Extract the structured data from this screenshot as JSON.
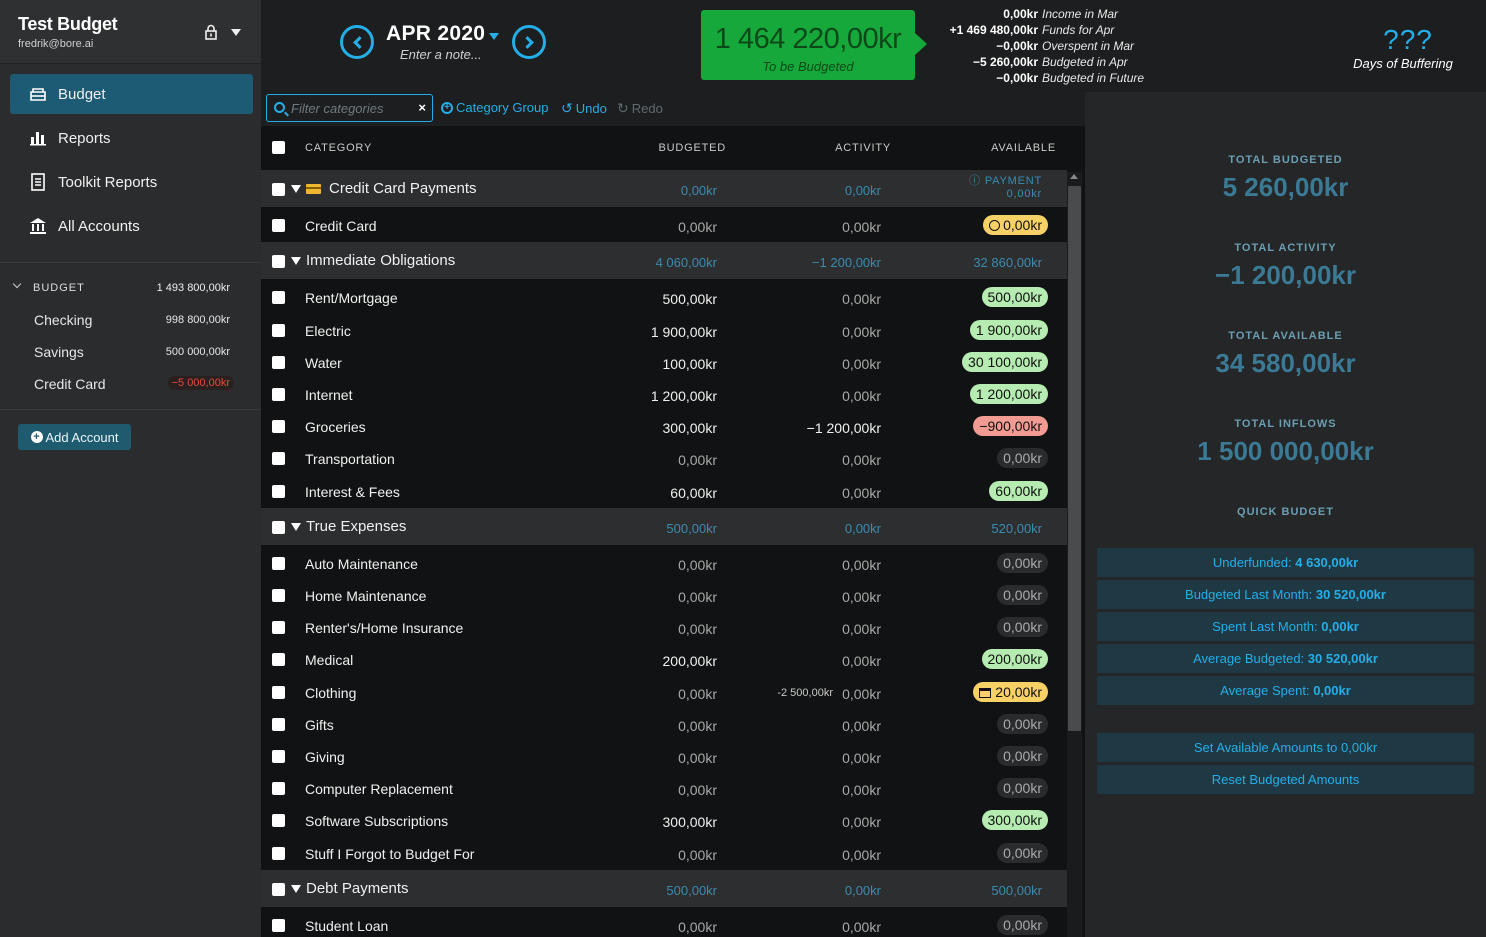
{
  "sidebar": {
    "title": "Test Budget",
    "email": "fredrik@bore.ai",
    "nav": [
      {
        "label": "Budget",
        "icon": "bank-card-icon"
      },
      {
        "label": "Reports",
        "icon": "bar-chart-icon"
      },
      {
        "label": "Toolkit Reports",
        "icon": "document-icon"
      },
      {
        "label": "All Accounts",
        "icon": "bank-icon"
      }
    ],
    "budget_header": {
      "label": "BUDGET",
      "value": "1 493 800,00kr"
    },
    "accounts": [
      {
        "name": "Checking",
        "value": "998 800,00kr"
      },
      {
        "name": "Savings",
        "value": "500 000,00kr"
      },
      {
        "name": "Credit Card",
        "value": "−5 000,00kr"
      }
    ],
    "add_account": "Add Account"
  },
  "header": {
    "month": "APR 2020",
    "note_placeholder": "Enter a note...",
    "to_be_budgeted": "1 464 220,00kr",
    "to_be_budgeted_label": "To be Budgeted",
    "summary": [
      {
        "amount": "0,00kr",
        "label": "Income in Mar"
      },
      {
        "amount": "+1 469 480,00kr",
        "label": "Funds for Apr"
      },
      {
        "amount": "−0,00kr",
        "label": "Overspent in Mar"
      },
      {
        "amount": "−5 260,00kr",
        "label": "Budgeted in Apr"
      },
      {
        "amount": "−0,00kr",
        "label": "Budgeted in Future"
      }
    ],
    "days_of_buffering_value": "???",
    "days_of_buffering_label": "Days of Buffering"
  },
  "toolbar": {
    "filter_placeholder": "Filter categories",
    "category_group": "Category Group",
    "undo": "Undo",
    "redo": "Redo"
  },
  "columns": {
    "category": "CATEGORY",
    "budgeted": "BUDGETED",
    "activity": "ACTIVITY",
    "available": "AVAILABLE"
  },
  "groups": {
    "ccp": {
      "name": "Credit Card Payments",
      "budgeted": "0,00kr",
      "activity": "0,00kr",
      "payment_label": "PAYMENT",
      "available": "0,00kr"
    },
    "io": {
      "name": "Immediate Obligations",
      "budgeted": "4 060,00kr",
      "activity": "−1 200,00kr",
      "available": "32 860,00kr"
    },
    "te": {
      "name": "True Expenses",
      "budgeted": "500,00kr",
      "activity": "0,00kr",
      "available": "520,00kr"
    },
    "dp": {
      "name": "Debt Payments",
      "budgeted": "500,00kr",
      "activity": "0,00kr",
      "available": "500,00kr"
    }
  },
  "rows": {
    "credit_card": {
      "name": "Credit Card",
      "budgeted": "0,00kr",
      "activity": "0,00kr",
      "available": "0,00kr"
    },
    "rent": {
      "name": "Rent/Mortgage",
      "budgeted": "500,00kr",
      "activity": "0,00kr",
      "available": "500,00kr"
    },
    "electric": {
      "name": "Electric",
      "budgeted": "1 900,00kr",
      "activity": "0,00kr",
      "available": "1 900,00kr"
    },
    "water": {
      "name": "Water",
      "budgeted": "100,00kr",
      "activity": "0,00kr",
      "available": "30 100,00kr"
    },
    "internet": {
      "name": "Internet",
      "budgeted": "1 200,00kr",
      "activity": "0,00kr",
      "available": "1 200,00kr"
    },
    "groceries": {
      "name": "Groceries",
      "budgeted": "300,00kr",
      "activity": "−1 200,00kr",
      "available": "−900,00kr"
    },
    "transportation": {
      "name": "Transportation",
      "budgeted": "0,00kr",
      "activity": "0,00kr",
      "available": "0,00kr"
    },
    "interest": {
      "name": "Interest & Fees",
      "budgeted": "60,00kr",
      "activity": "0,00kr",
      "available": "60,00kr"
    },
    "auto": {
      "name": "Auto Maintenance",
      "budgeted": "0,00kr",
      "activity": "0,00kr",
      "available": "0,00kr"
    },
    "home": {
      "name": "Home Maintenance",
      "budgeted": "0,00kr",
      "activity": "0,00kr",
      "available": "0,00kr"
    },
    "renters": {
      "name": "Renter's/Home Insurance",
      "budgeted": "0,00kr",
      "activity": "0,00kr",
      "available": "0,00kr"
    },
    "medical": {
      "name": "Medical",
      "budgeted": "200,00kr",
      "activity": "0,00kr",
      "available": "200,00kr"
    },
    "clothing": {
      "name": "Clothing",
      "budgeted": "0,00kr",
      "goal_note": "-2 500,00kr",
      "activity": "0,00kr",
      "available": "20,00kr"
    },
    "gifts": {
      "name": "Gifts",
      "budgeted": "0,00kr",
      "activity": "0,00kr",
      "available": "0,00kr"
    },
    "giving": {
      "name": "Giving",
      "budgeted": "0,00kr",
      "activity": "0,00kr",
      "available": "0,00kr"
    },
    "computer": {
      "name": "Computer Replacement",
      "budgeted": "0,00kr",
      "activity": "0,00kr",
      "available": "0,00kr"
    },
    "software": {
      "name": "Software Subscriptions",
      "budgeted": "300,00kr",
      "activity": "0,00kr",
      "available": "300,00kr"
    },
    "stuff": {
      "name": "Stuff I Forgot to Budget For",
      "budgeted": "0,00kr",
      "activity": "0,00kr",
      "available": "0,00kr"
    },
    "student": {
      "name": "Student Loan",
      "budgeted": "0,00kr",
      "activity": "0,00kr",
      "available": "0,00kr"
    }
  },
  "inspector": {
    "total_budgeted_label": "TOTAL BUDGETED",
    "total_budgeted": "5 260,00kr",
    "total_activity_label": "TOTAL ACTIVITY",
    "total_activity": "−1 200,00kr",
    "total_available_label": "TOTAL AVAILABLE",
    "total_available": "34 580,00kr",
    "total_inflows_label": "TOTAL INFLOWS",
    "total_inflows": "1 500 000,00kr",
    "quick_budget_label": "QUICK BUDGET",
    "quick": [
      {
        "label": "Underfunded: ",
        "value": "4 630,00kr"
      },
      {
        "label": "Budgeted Last Month: ",
        "value": "30 520,00kr"
      },
      {
        "label": "Spent Last Month: ",
        "value": "0,00kr"
      },
      {
        "label": "Average Budgeted: ",
        "value": "30 520,00kr"
      },
      {
        "label": "Average Spent: ",
        "value": "0,00kr"
      }
    ],
    "set_available": "Set Available Amounts to 0,00kr",
    "reset_budgeted": "Reset Budgeted Amounts"
  },
  "colors": {
    "accent": "#24aee8",
    "to_be_budgeted_bg": "#16a83a",
    "sidebar_active": "#1d5a73",
    "positive": "#b6ecb1",
    "negative": "#f19b92",
    "warning": "#f8d166"
  }
}
